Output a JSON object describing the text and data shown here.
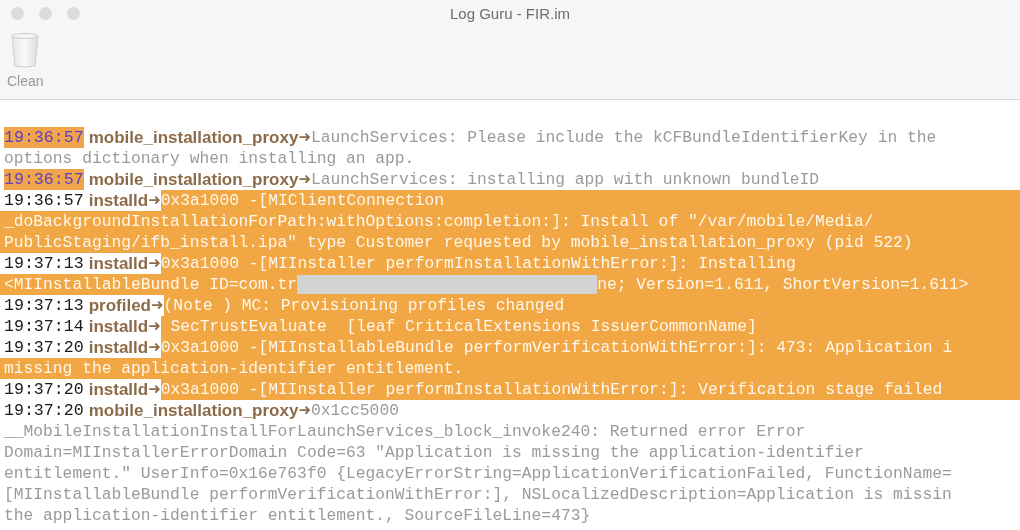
{
  "window": {
    "title": "Log Guru - FIR.im"
  },
  "toolbar": {
    "items": [
      {
        "label": "Clean"
      }
    ]
  },
  "log": {
    "entries": [
      {
        "time": "19:36:57",
        "time_highlighted": true,
        "process": "mobile_installation_proxy",
        "separator": "➜",
        "message_highlighted": false,
        "lines": [
          {
            "kind": "text",
            "text": "LaunchServices: Please include the kCFBundleIdentifierKey in the"
          },
          {
            "kind": "text",
            "text": "options dictionary when installing an app."
          }
        ]
      },
      {
        "time": "19:36:57",
        "time_highlighted": true,
        "process": "mobile_installation_proxy",
        "separator": "➜",
        "message_highlighted": false,
        "lines": [
          {
            "kind": "text",
            "text": "LaunchServices: installing app with unknown bundleID"
          }
        ]
      },
      {
        "time": "19:36:57",
        "time_highlighted": false,
        "process": "installd",
        "separator": "➜",
        "message_highlighted": true,
        "lines": [
          {
            "kind": "text",
            "text": "0x3a1000 -[MIClientConnection"
          },
          {
            "kind": "text",
            "text": "_doBackgroundInstallationForPath:withOptions:completion:]: Install of \"/var/mobile/Media/"
          },
          {
            "kind": "text",
            "text": "PublicStaging/ifb_install.ipa\" type Customer requested by mobile_installation_proxy (pid 522)"
          }
        ]
      },
      {
        "time": "19:37:13",
        "time_highlighted": false,
        "process": "installd",
        "separator": "➜",
        "message_highlighted": true,
        "lines": [
          {
            "kind": "text",
            "text": "0x3a1000 -[MIInstaller performInstallationWithError:]: Installing"
          },
          {
            "kind": "redacted",
            "before": "<MIInstallableBundle ID=com.tr",
            "after": "ne; Version=1.611, ShortVersion=1.611>"
          }
        ]
      },
      {
        "time": "19:37:13",
        "time_highlighted": false,
        "process": "profiled",
        "separator": "➜",
        "message_highlighted": true,
        "lines": [
          {
            "kind": "text",
            "text": "(Note ) MC: Provisioning profiles changed"
          }
        ]
      },
      {
        "time": "19:37:14",
        "time_highlighted": false,
        "process": "installd",
        "separator": "➜",
        "message_highlighted": true,
        "lines": [
          {
            "kind": "text",
            "text": " SecTrustEvaluate  [leaf CriticalExtensions IssuerCommonName]"
          }
        ]
      },
      {
        "time": "19:37:20",
        "time_highlighted": false,
        "process": "installd",
        "separator": "➜",
        "message_highlighted": true,
        "lines": [
          {
            "kind": "text",
            "text": "0x3a1000 -[MIInstallableBundle performVerificationWithError:]: 473: Application i"
          },
          {
            "kind": "text",
            "text": "missing the application-identifier entitlement."
          }
        ]
      },
      {
        "time": "19:37:20",
        "time_highlighted": false,
        "process": "installd",
        "separator": "➜",
        "message_highlighted": true,
        "lines": [
          {
            "kind": "text",
            "text": "0x3a1000 -[MIInstaller performInstallationWithError:]: Verification stage failed"
          }
        ]
      },
      {
        "time": "19:37:20",
        "time_highlighted": false,
        "process": "mobile_installation_proxy",
        "separator": "➜",
        "message_highlighted": false,
        "lines": [
          {
            "kind": "text",
            "text": "0x1cc5000"
          },
          {
            "kind": "text",
            "text": "__MobileInstallationInstallForLaunchServices_block_invoke240: Returned error Error"
          },
          {
            "kind": "text",
            "text": "Domain=MIInstallerErrorDomain Code=63 \"Application is missing the application-identifier"
          },
          {
            "kind": "text",
            "text": "entitlement.\" UserInfo=0x16e763f0 {LegacyErrorString=ApplicationVerificationFailed, FunctionName="
          },
          {
            "kind": "text",
            "text": "[MIInstallableBundle performVerificationWithError:], NSLocalizedDescription=Application is missin"
          },
          {
            "kind": "text",
            "text": "the application-identifier entitlement., SourceFileLine=473}"
          }
        ]
      }
    ]
  }
}
